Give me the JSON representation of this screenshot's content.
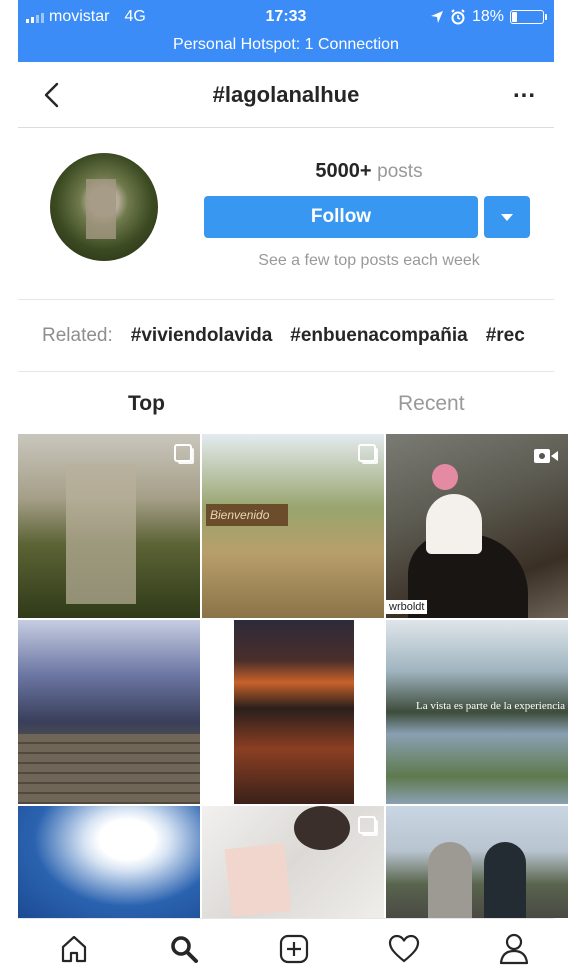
{
  "status_bar": {
    "carrier": "movistar",
    "network": "4G",
    "time": "17:33",
    "battery": "18%",
    "battery_fraction": 0.18,
    "hotspot": "Personal Hotspot: 1 Connection"
  },
  "header": {
    "title": "#lagolanalhue",
    "more": "..."
  },
  "profile": {
    "post_count": "5000+",
    "post_label": "posts",
    "follow_label": "Follow",
    "hint": "See a few top posts each week"
  },
  "related": {
    "label": "Related:",
    "tags": [
      "#viviendolavida",
      "#enbuenacompañia",
      "#rec"
    ]
  },
  "tabs": {
    "top": "Top",
    "recent": "Recent"
  },
  "grid": {
    "tile3_watermark": "wrboldt",
    "tile6_caption": "La vista es parte de la experiencia"
  },
  "icons": {
    "back": "chevron-left-icon",
    "home": "home-icon",
    "search": "search-icon",
    "add": "add-post-icon",
    "activity": "heart-icon",
    "profile": "profile-icon"
  },
  "colors": {
    "status_bar": "#3b8cf7",
    "follow_button": "#3897f0"
  }
}
